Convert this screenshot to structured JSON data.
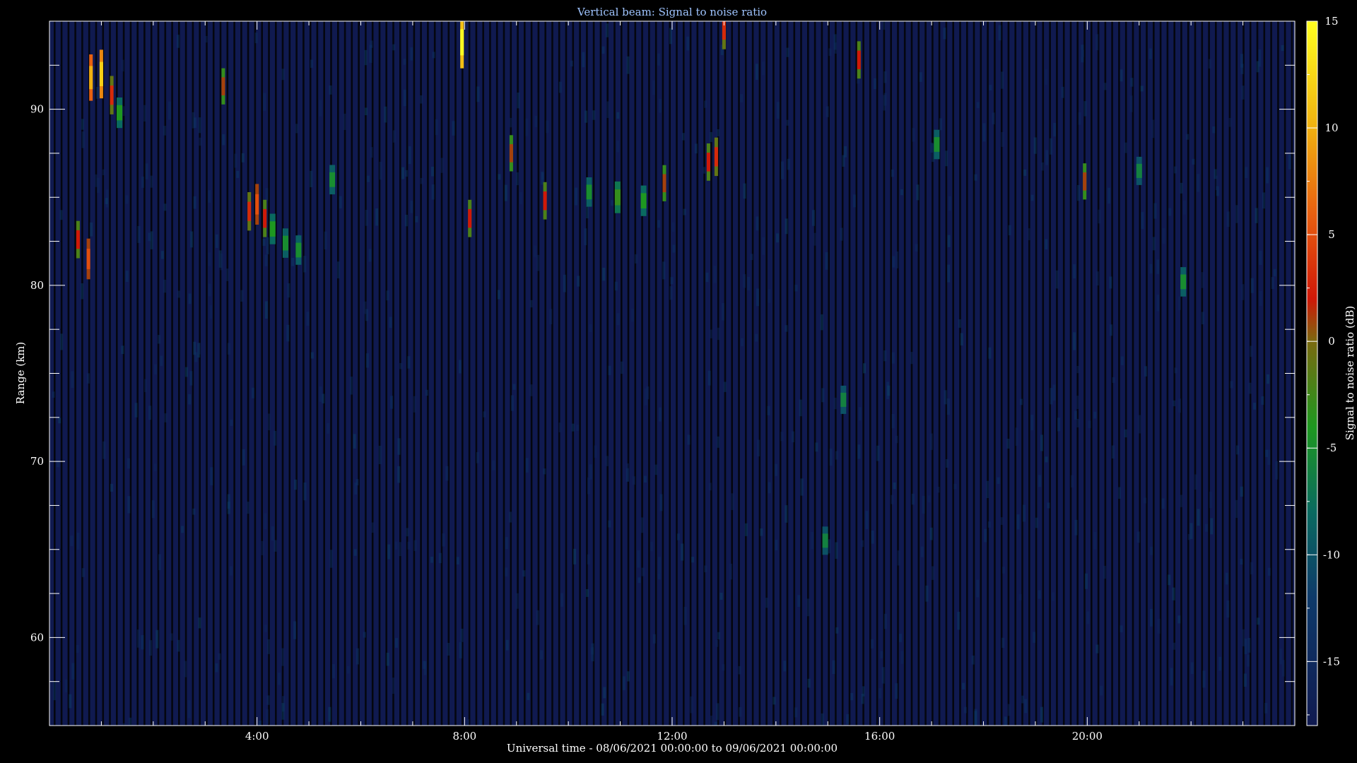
{
  "chart_data": {
    "type": "heatmap",
    "title": "Vertical beam: Signal to noise ratio",
    "xlabel": "Universal time - 08/06/2021 00:00:00 to 09/06/2021 00:00:00",
    "ylabel": "Range (km)",
    "colorbar_label": "Signal to noise ratio (dB)",
    "xlim_hours": [
      0,
      24
    ],
    "ylim_km": [
      55,
      95
    ],
    "x_ticks": [
      {
        "hour": 4,
        "label": "4:00"
      },
      {
        "hour": 8,
        "label": "8:00"
      },
      {
        "hour": 12,
        "label": "12:00"
      },
      {
        "hour": 16,
        "label": "16:00"
      },
      {
        "hour": 20,
        "label": "20:00"
      }
    ],
    "y_ticks": [
      {
        "km": 60,
        "label": "60"
      },
      {
        "km": 70,
        "label": "70"
      },
      {
        "km": 80,
        "label": "80"
      },
      {
        "km": 90,
        "label": "90"
      }
    ],
    "colorbar_range_db": [
      -18,
      15
    ],
    "colorbar_ticks": [
      {
        "db": 15,
        "label": "15"
      },
      {
        "db": 10,
        "label": "10"
      },
      {
        "db": 5,
        "label": "5"
      },
      {
        "db": 0,
        "label": "0"
      },
      {
        "db": -5,
        "label": "-5"
      },
      {
        "db": -10,
        "label": "-10"
      },
      {
        "db": -15,
        "label": "-15"
      }
    ],
    "background_snr_db": -16,
    "colormap": [
      {
        "db": -18,
        "color": "#101a50"
      },
      {
        "db": -12,
        "color": "#0e3a6a"
      },
      {
        "db": -8,
        "color": "#0a6a60"
      },
      {
        "db": -4,
        "color": "#1e9820"
      },
      {
        "db": 0,
        "color": "#7a6a10"
      },
      {
        "db": 2,
        "color": "#d01808"
      },
      {
        "db": 6,
        "color": "#e86010"
      },
      {
        "db": 10,
        "color": "#f0b010"
      },
      {
        "db": 15,
        "color": "#ffff20"
      }
    ],
    "echoes": [
      {
        "hour": 0.55,
        "km": 82.6,
        "snr_db": 2
      },
      {
        "hour": 0.75,
        "km": 81.5,
        "snr_db": 5
      },
      {
        "hour": 0.8,
        "km": 91.8,
        "snr_db": 10
      },
      {
        "hour": 1.0,
        "km": 92.0,
        "snr_db": 12
      },
      {
        "hour": 1.2,
        "km": 90.8,
        "snr_db": 3
      },
      {
        "hour": 1.35,
        "km": 89.8,
        "snr_db": -4
      },
      {
        "hour": 3.35,
        "km": 91.3,
        "snr_db": 1
      },
      {
        "hour": 3.85,
        "km": 84.2,
        "snr_db": 3
      },
      {
        "hour": 4.0,
        "km": 84.6,
        "snr_db": 5
      },
      {
        "hour": 4.15,
        "km": 83.8,
        "snr_db": 2
      },
      {
        "hour": 4.3,
        "km": 83.2,
        "snr_db": -4
      },
      {
        "hour": 4.55,
        "km": 82.4,
        "snr_db": -5
      },
      {
        "hour": 4.8,
        "km": 82.0,
        "snr_db": -5
      },
      {
        "hour": 5.45,
        "km": 86.0,
        "snr_db": -5
      },
      {
        "hour": 7.95,
        "km": 93.8,
        "snr_db": 15
      },
      {
        "hour": 8.1,
        "km": 83.8,
        "snr_db": 2
      },
      {
        "hour": 8.9,
        "km": 87.5,
        "snr_db": 1
      },
      {
        "hour": 9.55,
        "km": 84.8,
        "snr_db": 2
      },
      {
        "hour": 10.4,
        "km": 85.3,
        "snr_db": -5
      },
      {
        "hour": 10.95,
        "km": 85.0,
        "snr_db": -3
      },
      {
        "hour": 11.45,
        "km": 84.8,
        "snr_db": -4
      },
      {
        "hour": 11.85,
        "km": 85.8,
        "snr_db": 1
      },
      {
        "hour": 12.7,
        "km": 87.0,
        "snr_db": 2
      },
      {
        "hour": 12.85,
        "km": 87.3,
        "snr_db": 3
      },
      {
        "hour": 13.0,
        "km": 94.5,
        "snr_db": 3
      },
      {
        "hour": 14.95,
        "km": 65.5,
        "snr_db": -6
      },
      {
        "hour": 15.3,
        "km": 73.5,
        "snr_db": -6
      },
      {
        "hour": 15.6,
        "km": 92.8,
        "snr_db": 2
      },
      {
        "hour": 17.1,
        "km": 88.0,
        "snr_db": -5
      },
      {
        "hour": 19.95,
        "km": 85.9,
        "snr_db": 1
      },
      {
        "hour": 21.0,
        "km": 86.5,
        "snr_db": -6
      },
      {
        "hour": 21.85,
        "km": 80.2,
        "snr_db": -5
      }
    ]
  }
}
